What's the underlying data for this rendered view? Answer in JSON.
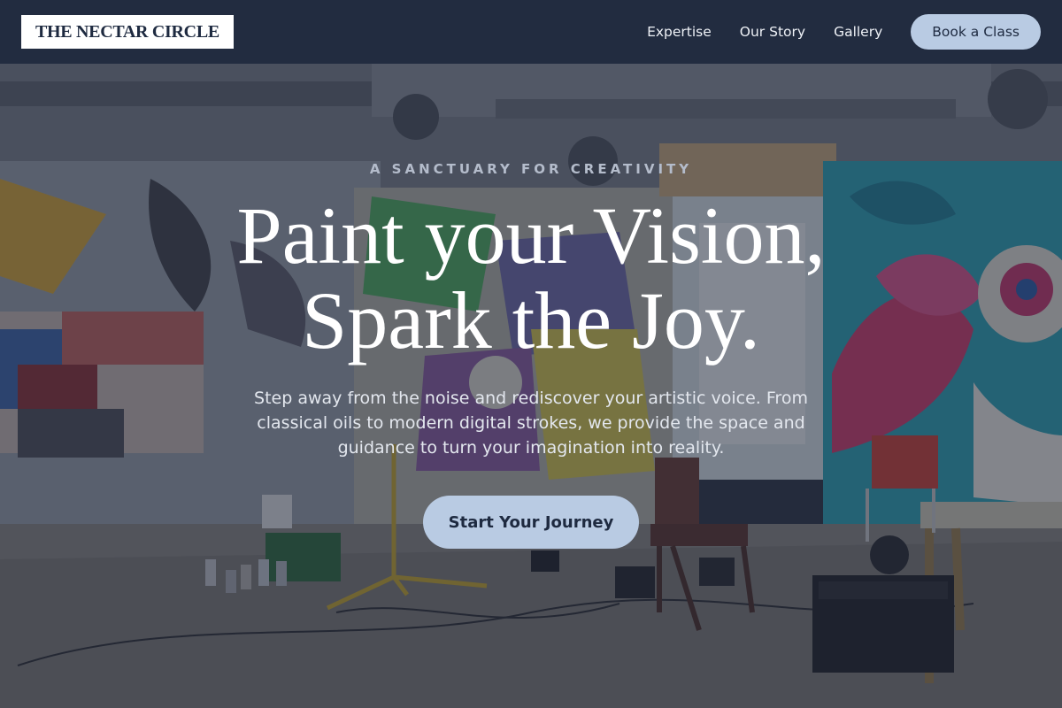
{
  "header": {
    "logo_text": "THE NECTAR CIRCLE",
    "nav": [
      {
        "label": "Expertise"
      },
      {
        "label": "Our Story"
      },
      {
        "label": "Gallery"
      }
    ],
    "cta_label": "Book a Class"
  },
  "hero": {
    "eyebrow": "A SANCTUARY FOR CREATIVITY",
    "headline_line1": "Paint your Vision,",
    "headline_line2": "Spark the Joy.",
    "subtext": "Step away from the noise and rediscover your artistic voice. From classical oils to modern digital strokes, we provide the space and guidance to turn your imagination into reality.",
    "cta_label": "Start Your Journey"
  },
  "colors": {
    "header_bg": "#222c40",
    "accent": "#b9cbe3",
    "text_dark": "#1e2a40"
  }
}
